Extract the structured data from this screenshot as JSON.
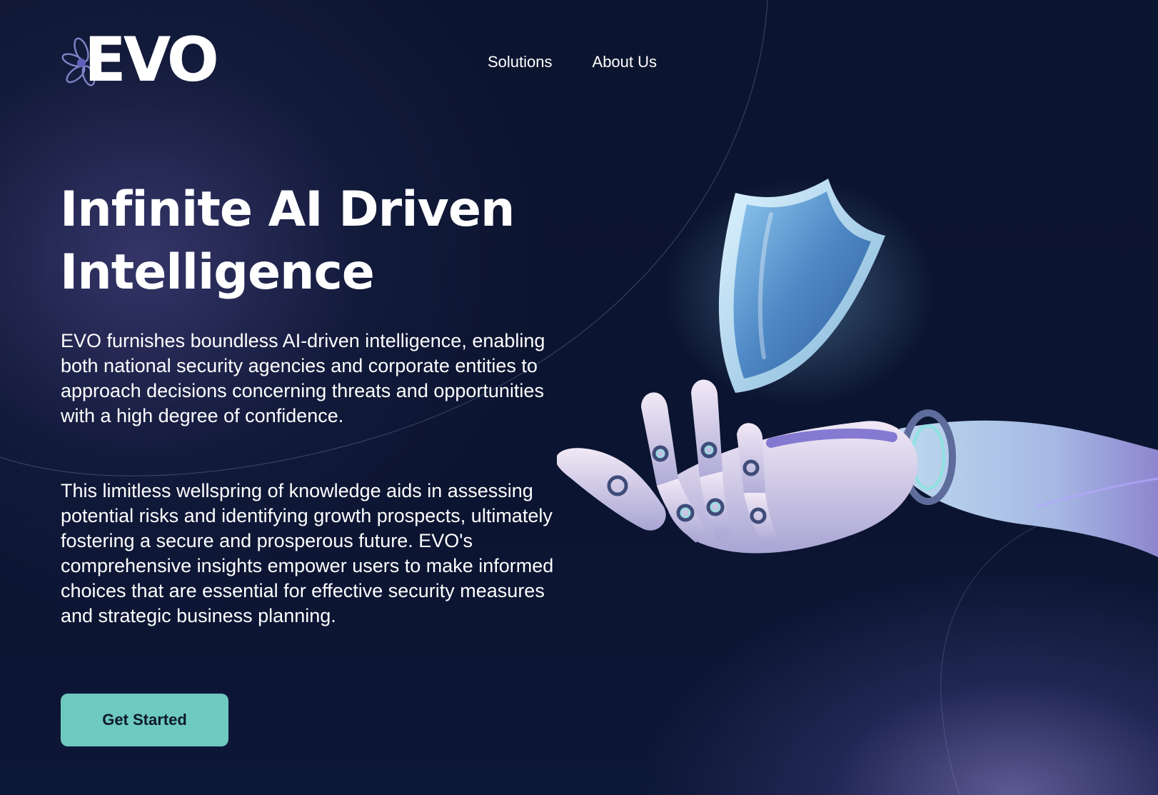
{
  "brand": {
    "logo_text": "EVO",
    "logo_icon": "flower-logo-icon"
  },
  "nav": {
    "items": [
      {
        "label": "Solutions"
      },
      {
        "label": "About Us"
      }
    ]
  },
  "hero": {
    "title_line1": "Infinite AI Driven",
    "title_line2": "Intelligence",
    "paragraph1": "EVO furnishes boundless AI-driven intelligence, enabling both national security agencies and corporate entities to approach decisions concerning threats and opportunities with a high degree of confidence.",
    "paragraph2": "This limitless wellspring of knowledge aids in assessing potential risks and identifying growth prospects, ultimately fostering a secure and prosperous future. EVO's comprehensive insights empower users to make informed choices that are essential for effective security measures and strategic business planning.",
    "cta_label": "Get Started",
    "illustration": "robotic-hand-holding-shield-icon"
  },
  "colors": {
    "background": "#0b1430",
    "accent": "#6ec9bf",
    "text": "#ffffff"
  }
}
